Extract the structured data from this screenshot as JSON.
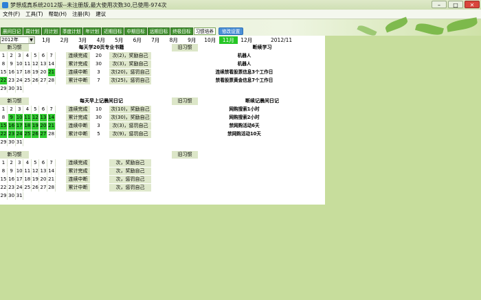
{
  "window": {
    "title": "梦想成真系统2012版--未注册版,最大使用次数30,已使用-974次",
    "controls": [
      "–",
      "□",
      "✕"
    ]
  },
  "menu": [
    "文件(F)",
    "工具(T)",
    "帮助(H)",
    "注册(R)",
    "建议"
  ],
  "tabs": [
    "晨间日记",
    "周计划",
    "月计划",
    "季度计划",
    "年计划",
    "近期目标",
    "中期目标",
    "远期目标",
    "终极目标",
    "习惯培养"
  ],
  "active_tab": "习惯培养",
  "tab_button": "修改设置",
  "year": "2012年",
  "months": [
    "1月",
    "2月",
    "3月",
    "4月",
    "5月",
    "6月",
    "7月",
    "8月",
    "9月",
    "10月",
    "11月",
    "12月"
  ],
  "active_month": "11月",
  "current_date": "2012/11",
  "days": [
    [
      1,
      2,
      3,
      4,
      5,
      6,
      7
    ],
    [
      8,
      9,
      10,
      11,
      12,
      13,
      14
    ],
    [
      15,
      16,
      17,
      18,
      19,
      20,
      21
    ],
    [
      22,
      23,
      24,
      25,
      26,
      27,
      28
    ],
    [
      29,
      30,
      31
    ]
  ],
  "sections": [
    {
      "new_label": "新习惯",
      "habit": "每天学20页专业书籍",
      "old_label": "旧习惯",
      "old_habit": "断续学习",
      "green": [
        21,
        22
      ],
      "stats": [
        {
          "label": "连续完成",
          "value": "20",
          "unit": "次(2)，奖励自己",
          "reward": "机器人"
        },
        {
          "label": "累计完成",
          "value": "30",
          "unit": "次(3)，奖励自己",
          "reward": "机器人"
        },
        {
          "label": "连续中断",
          "value": "3",
          "unit": "次(20)，惩罚自己",
          "reward": "连续禁看股票信息3个工作日"
        },
        {
          "label": "累计中断",
          "value": "7",
          "unit": "次(25)，惩罚自己",
          "reward": "禁看股票黄金信息7个工作日"
        }
      ]
    },
    {
      "new_label": "新习惯",
      "habit": "每天早上记晨间日记",
      "old_label": "旧习惯",
      "old_habit": "断续记晨间日记",
      "green": [
        9,
        10,
        11,
        12,
        13,
        14,
        15,
        16,
        17,
        18,
        19,
        20,
        21,
        22,
        23,
        24,
        25,
        26,
        27
      ],
      "stats": [
        {
          "label": "连续完成",
          "value": "10",
          "unit": "次(10)，奖励自己",
          "reward": "网购搜索1小时"
        },
        {
          "label": "累计完成",
          "value": "30",
          "unit": "次(30)，奖励自己",
          "reward": "网购搜索2小时"
        },
        {
          "label": "连续中断",
          "value": "3",
          "unit": "次(3)，惩罚自己",
          "reward": "禁网购活动6天"
        },
        {
          "label": "累计中断",
          "value": "5",
          "unit": "次(9)，惩罚自己",
          "reward": "禁网购活动10天"
        }
      ]
    },
    {
      "new_label": "新习惯",
      "habit": "",
      "old_label": "旧习惯",
      "old_habit": "",
      "green": [],
      "stats": [
        {
          "label": "连续完成",
          "value": "",
          "unit": "次，奖励自己",
          "reward": ""
        },
        {
          "label": "累计完成",
          "value": "",
          "unit": "次，奖励自己",
          "reward": ""
        },
        {
          "label": "连续中断",
          "value": "",
          "unit": "次，惩罚自己",
          "reward": ""
        },
        {
          "label": "累计中断",
          "value": "",
          "unit": "次，惩罚自己",
          "reward": ""
        }
      ]
    }
  ]
}
